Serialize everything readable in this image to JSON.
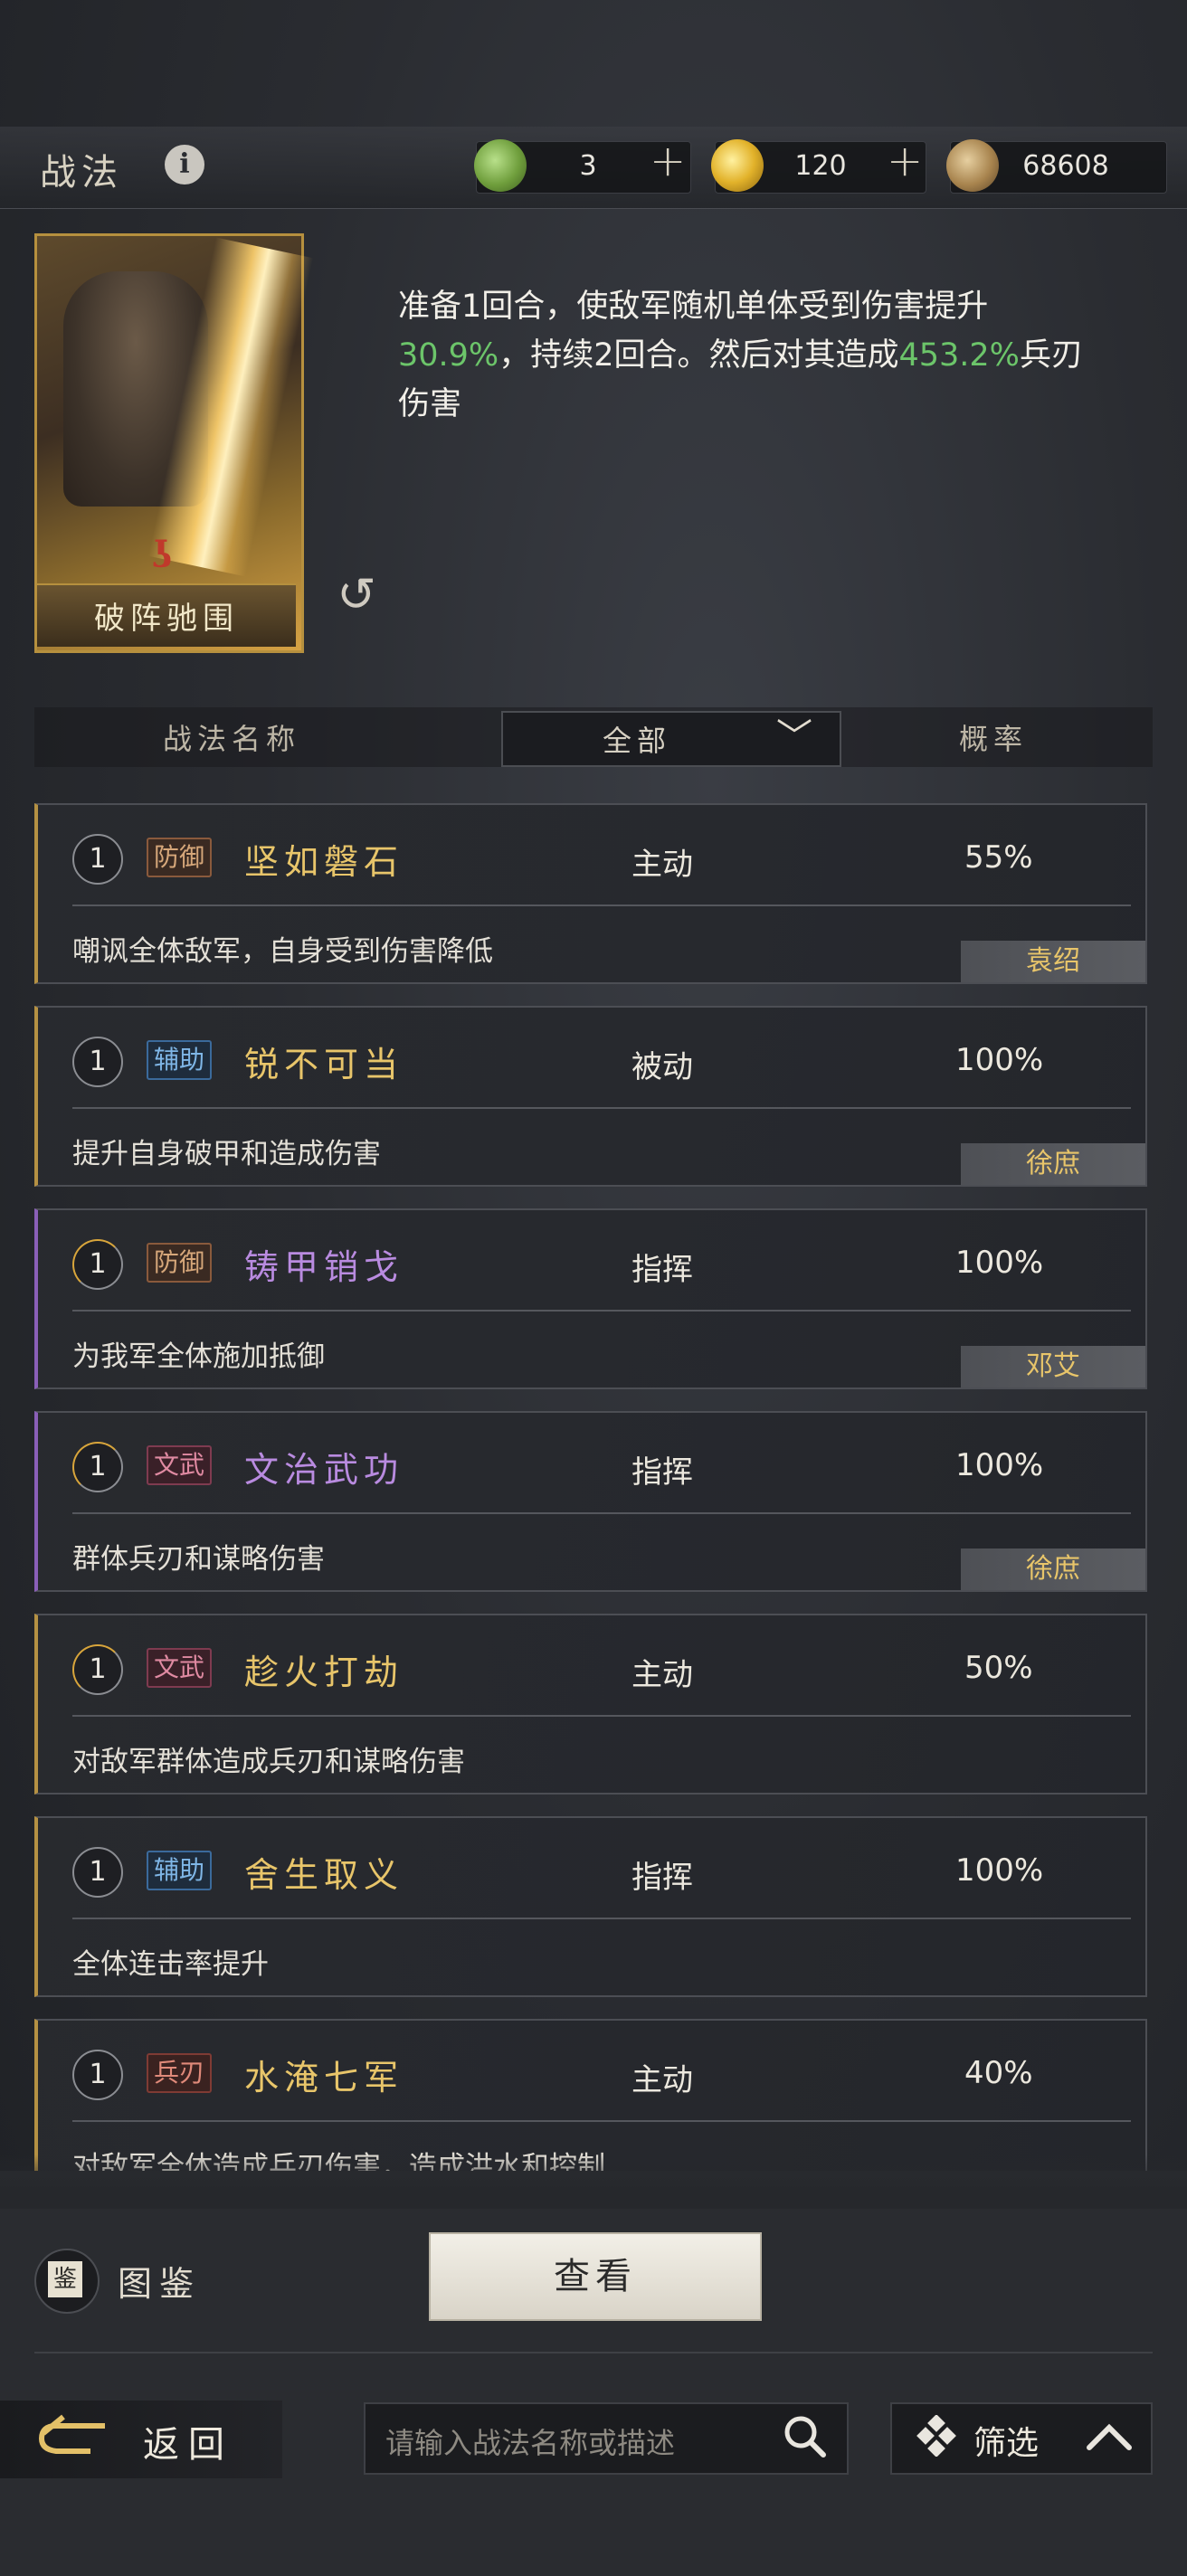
{
  "header": {
    "title": "战法",
    "info_icon": "i",
    "currencies": [
      {
        "icon": "jade-coin-icon",
        "value": "3",
        "plus": "+"
      },
      {
        "icon": "gold-coin-icon",
        "value": "120",
        "plus": "+"
      },
      {
        "icon": "copper-coin-icon",
        "value": "68608"
      }
    ]
  },
  "hero": {
    "name": "破阵驰围",
    "description_parts": [
      "准备1回合，使敌军随机单体受到伤害提升",
      "30.9%",
      "，持续2回合。然后对其造成",
      "453.2%",
      "兵刃伤害"
    ]
  },
  "table_header": {
    "name_col": "战法名称",
    "filter_value": "全部",
    "rate_col": "概率"
  },
  "tactics": [
    {
      "level": "1",
      "tag": "防御",
      "name": "坚如磐石",
      "type": "主动",
      "rate": "55%",
      "desc": "嘲讽全体敌军，自身受到伤害降低",
      "hero": "袁绍"
    },
    {
      "level": "1",
      "tag": "辅助",
      "name": "锐不可当",
      "type": "被动",
      "rate": "100%",
      "desc": "提升自身破甲和造成伤害",
      "hero": "徐庶"
    },
    {
      "level": "1",
      "tag": "防御",
      "name": "铸甲销戈",
      "type": "指挥",
      "rate": "100%",
      "desc": "为我军全体施加抵御",
      "hero": "邓艾"
    },
    {
      "level": "1",
      "tag": "文武",
      "name": "文治武功",
      "type": "指挥",
      "rate": "100%",
      "desc": "群体兵刃和谋略伤害",
      "hero": "徐庶"
    },
    {
      "level": "1",
      "tag": "文武",
      "name": "趁火打劫",
      "type": "主动",
      "rate": "50%",
      "desc": "对敌军群体造成兵刃和谋略伤害",
      "hero": ""
    },
    {
      "level": "1",
      "tag": "辅助",
      "name": "舍生取义",
      "type": "指挥",
      "rate": "100%",
      "desc": "全体连击率提升",
      "hero": ""
    },
    {
      "level": "1",
      "tag": "兵刃",
      "name": "水淹七军",
      "type": "主动",
      "rate": "40%",
      "desc": "对敌军全体造成兵刃伤害，造成洪水和控制",
      "hero": ""
    }
  ],
  "bottom": {
    "tujian_glyph": "鉴",
    "tujian_label": "图鉴",
    "view_button": "查看",
    "back_label": "返回",
    "search_placeholder": "请输入战法名称或描述",
    "filter_label": "筛选"
  },
  "colors": {
    "accent_gold": "#e8c56a",
    "purple": "#b98be0",
    "green_value": "#6cc56a"
  }
}
